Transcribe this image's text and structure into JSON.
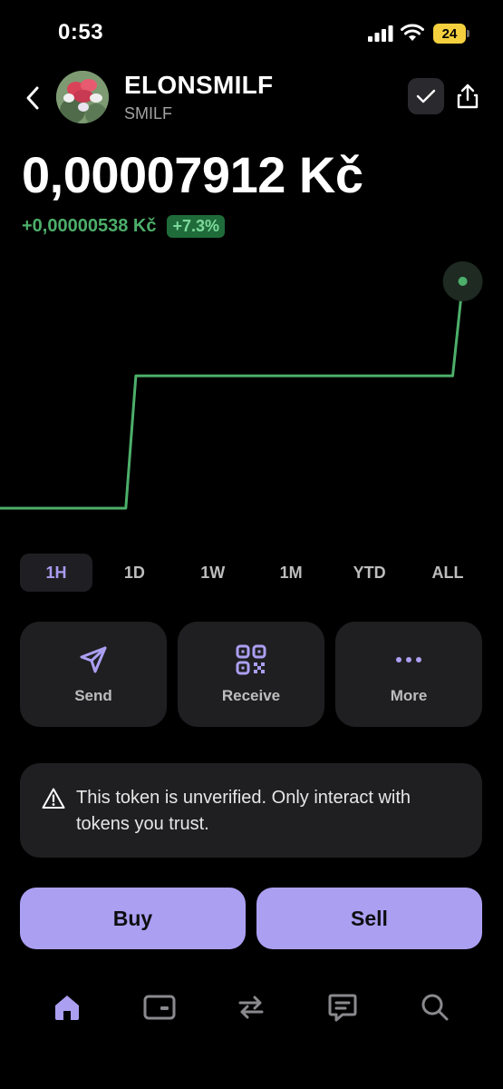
{
  "status_bar": {
    "time": "0:53",
    "battery": "24"
  },
  "token": {
    "name": "ELONSMILF",
    "symbol": "SMILF",
    "price": "0,00007912 Kč",
    "change_value": "+0,00000538 Kč",
    "change_percent": "+7.3%"
  },
  "colors": {
    "accent": "#ab9ff2",
    "positive": "#4caf6a",
    "background": "#000000",
    "card": "#1f1f21"
  },
  "chart_data": {
    "type": "line",
    "title": "",
    "xlabel": "",
    "ylabel": "",
    "series": [
      {
        "values": [
          6.62e-05,
          6.62e-05,
          6.62e-05,
          7.374e-05,
          7.374e-05,
          7.374e-05,
          7.374e-05,
          7.912e-05
        ]
      }
    ],
    "x": [
      0,
      0.24,
      0.25,
      0.27,
      0.5,
      0.88,
      0.9,
      0.92
    ],
    "grid": false,
    "legend": "none"
  },
  "timeframes": {
    "selected": "1H",
    "items": [
      "1H",
      "1D",
      "1W",
      "1M",
      "YTD",
      "ALL"
    ]
  },
  "actions": [
    {
      "label": "Send",
      "icon": "send-icon"
    },
    {
      "label": "Receive",
      "icon": "qr-code-icon"
    },
    {
      "label": "More",
      "icon": "more-dots-icon"
    }
  ],
  "warning": {
    "text": "This token is unverified. Only interact with tokens you trust.",
    "icon": "warning-triangle-icon"
  },
  "trade": {
    "buy": "Buy",
    "sell": "Sell"
  },
  "nav": [
    "home-icon",
    "wallet-card-icon",
    "swap-arrows-icon",
    "chat-icon",
    "search-icon"
  ]
}
